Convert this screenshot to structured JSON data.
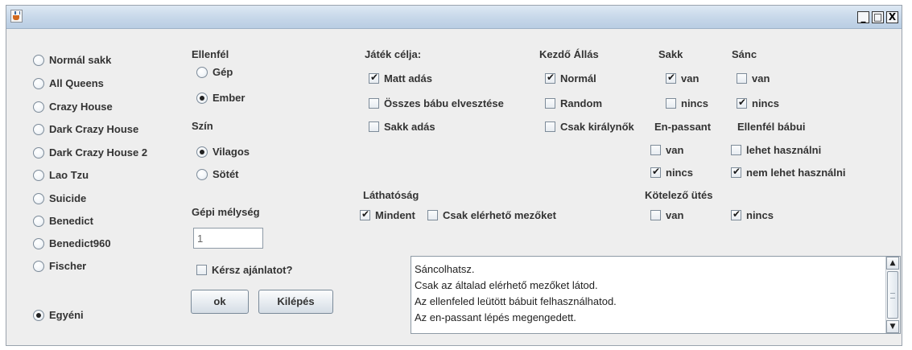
{
  "window": {
    "icons": {
      "app": "java-cup-icon",
      "minimize": "minimize-icon",
      "maximize": "maximize-icon",
      "close": "close-icon"
    },
    "controls": {
      "minimize": "_",
      "maximize": "□",
      "close": "X"
    }
  },
  "variants": {
    "items": [
      {
        "label": "Normál sakk",
        "selected": false
      },
      {
        "label": "All Queens",
        "selected": false
      },
      {
        "label": "Crazy House",
        "selected": false
      },
      {
        "label": "Dark Crazy House",
        "selected": false
      },
      {
        "label": "Dark Crazy House 2",
        "selected": false
      },
      {
        "label": "Lao Tzu",
        "selected": false
      },
      {
        "label": "Suicide",
        "selected": false
      },
      {
        "label": "Benedict",
        "selected": false
      },
      {
        "label": "Benedict960",
        "selected": false
      },
      {
        "label": "Fischer",
        "selected": false
      }
    ],
    "custom": {
      "label": "Egyéni",
      "selected": true
    }
  },
  "opponent": {
    "title": "Ellenfél",
    "options": [
      {
        "label": "Gép",
        "selected": false
      },
      {
        "label": "Ember",
        "selected": true
      }
    ]
  },
  "color": {
    "title": "Szín",
    "options": [
      {
        "label": "Vilagos",
        "selected": true
      },
      {
        "label": "Sötét",
        "selected": false
      }
    ]
  },
  "depth": {
    "title": "Gépi mélység",
    "value": "1"
  },
  "hint": {
    "label": "Kérsz ajánlatot?",
    "checked": false
  },
  "buttons": {
    "ok": "ok",
    "exit": "Kilépés"
  },
  "goal": {
    "title": "Játék célja:",
    "options": [
      {
        "label": "Matt adás",
        "checked": true
      },
      {
        "label": "Összes bábu elvesztése",
        "checked": false
      },
      {
        "label": "Sakk adás",
        "checked": false
      }
    ]
  },
  "start": {
    "title": "Kezdő Állás",
    "options": [
      {
        "label": "Normál",
        "checked": true
      },
      {
        "label": "Random",
        "checked": false
      },
      {
        "label": "Csak királynők",
        "checked": false
      }
    ]
  },
  "check_rule": {
    "title": "Sakk",
    "options": [
      {
        "label": "van",
        "checked": true
      },
      {
        "label": "nincs",
        "checked": false
      }
    ]
  },
  "castling": {
    "title": "Sánc",
    "options": [
      {
        "label": "van",
        "checked": false
      },
      {
        "label": "nincs",
        "checked": true
      }
    ]
  },
  "en_passant": {
    "title": "En-passant",
    "options": [
      {
        "label": "van",
        "checked": false
      },
      {
        "label": "nincs",
        "checked": true
      }
    ]
  },
  "opp_pieces": {
    "title": "Ellenfél bábui",
    "options": [
      {
        "label": "lehet használni",
        "checked": false
      },
      {
        "label": "nem lehet használni",
        "checked": true
      }
    ]
  },
  "visibility": {
    "title": "Láthatóság",
    "options": [
      {
        "label": "Mindent",
        "checked": true
      },
      {
        "label": "Csak elérhető mezőket",
        "checked": false
      }
    ]
  },
  "forced_capture": {
    "title": "Kötelező ütés",
    "options": [
      {
        "label": "van",
        "checked": false
      },
      {
        "label": "nincs",
        "checked": true
      }
    ]
  },
  "log": {
    "lines": [
      "Sáncolhatsz.",
      "Csak az általad elérhető mezőket látod.",
      "Az ellenfeled leütött bábuit felhasználhatod.",
      "Az en-passant lépés megengedett."
    ],
    "scroll": {
      "up": "▲",
      "down": "▼"
    }
  }
}
